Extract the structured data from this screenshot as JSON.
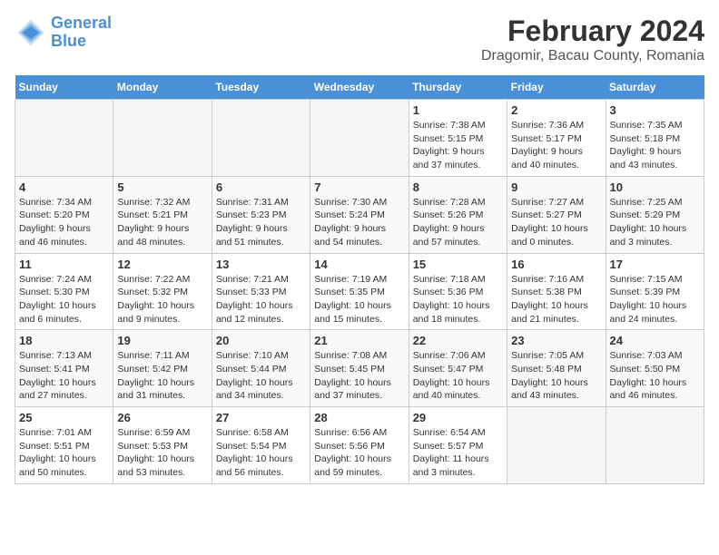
{
  "header": {
    "logo_line1": "General",
    "logo_line2": "Blue",
    "title": "February 2024",
    "subtitle": "Dragomir, Bacau County, Romania"
  },
  "weekdays": [
    "Sunday",
    "Monday",
    "Tuesday",
    "Wednesday",
    "Thursday",
    "Friday",
    "Saturday"
  ],
  "weeks": [
    [
      {
        "day": "",
        "info": ""
      },
      {
        "day": "",
        "info": ""
      },
      {
        "day": "",
        "info": ""
      },
      {
        "day": "",
        "info": ""
      },
      {
        "day": "1",
        "info": "Sunrise: 7:38 AM\nSunset: 5:15 PM\nDaylight: 9 hours\nand 37 minutes."
      },
      {
        "day": "2",
        "info": "Sunrise: 7:36 AM\nSunset: 5:17 PM\nDaylight: 9 hours\nand 40 minutes."
      },
      {
        "day": "3",
        "info": "Sunrise: 7:35 AM\nSunset: 5:18 PM\nDaylight: 9 hours\nand 43 minutes."
      }
    ],
    [
      {
        "day": "4",
        "info": "Sunrise: 7:34 AM\nSunset: 5:20 PM\nDaylight: 9 hours\nand 46 minutes."
      },
      {
        "day": "5",
        "info": "Sunrise: 7:32 AM\nSunset: 5:21 PM\nDaylight: 9 hours\nand 48 minutes."
      },
      {
        "day": "6",
        "info": "Sunrise: 7:31 AM\nSunset: 5:23 PM\nDaylight: 9 hours\nand 51 minutes."
      },
      {
        "day": "7",
        "info": "Sunrise: 7:30 AM\nSunset: 5:24 PM\nDaylight: 9 hours\nand 54 minutes."
      },
      {
        "day": "8",
        "info": "Sunrise: 7:28 AM\nSunset: 5:26 PM\nDaylight: 9 hours\nand 57 minutes."
      },
      {
        "day": "9",
        "info": "Sunrise: 7:27 AM\nSunset: 5:27 PM\nDaylight: 10 hours\nand 0 minutes."
      },
      {
        "day": "10",
        "info": "Sunrise: 7:25 AM\nSunset: 5:29 PM\nDaylight: 10 hours\nand 3 minutes."
      }
    ],
    [
      {
        "day": "11",
        "info": "Sunrise: 7:24 AM\nSunset: 5:30 PM\nDaylight: 10 hours\nand 6 minutes."
      },
      {
        "day": "12",
        "info": "Sunrise: 7:22 AM\nSunset: 5:32 PM\nDaylight: 10 hours\nand 9 minutes."
      },
      {
        "day": "13",
        "info": "Sunrise: 7:21 AM\nSunset: 5:33 PM\nDaylight: 10 hours\nand 12 minutes."
      },
      {
        "day": "14",
        "info": "Sunrise: 7:19 AM\nSunset: 5:35 PM\nDaylight: 10 hours\nand 15 minutes."
      },
      {
        "day": "15",
        "info": "Sunrise: 7:18 AM\nSunset: 5:36 PM\nDaylight: 10 hours\nand 18 minutes."
      },
      {
        "day": "16",
        "info": "Sunrise: 7:16 AM\nSunset: 5:38 PM\nDaylight: 10 hours\nand 21 minutes."
      },
      {
        "day": "17",
        "info": "Sunrise: 7:15 AM\nSunset: 5:39 PM\nDaylight: 10 hours\nand 24 minutes."
      }
    ],
    [
      {
        "day": "18",
        "info": "Sunrise: 7:13 AM\nSunset: 5:41 PM\nDaylight: 10 hours\nand 27 minutes."
      },
      {
        "day": "19",
        "info": "Sunrise: 7:11 AM\nSunset: 5:42 PM\nDaylight: 10 hours\nand 31 minutes."
      },
      {
        "day": "20",
        "info": "Sunrise: 7:10 AM\nSunset: 5:44 PM\nDaylight: 10 hours\nand 34 minutes."
      },
      {
        "day": "21",
        "info": "Sunrise: 7:08 AM\nSunset: 5:45 PM\nDaylight: 10 hours\nand 37 minutes."
      },
      {
        "day": "22",
        "info": "Sunrise: 7:06 AM\nSunset: 5:47 PM\nDaylight: 10 hours\nand 40 minutes."
      },
      {
        "day": "23",
        "info": "Sunrise: 7:05 AM\nSunset: 5:48 PM\nDaylight: 10 hours\nand 43 minutes."
      },
      {
        "day": "24",
        "info": "Sunrise: 7:03 AM\nSunset: 5:50 PM\nDaylight: 10 hours\nand 46 minutes."
      }
    ],
    [
      {
        "day": "25",
        "info": "Sunrise: 7:01 AM\nSunset: 5:51 PM\nDaylight: 10 hours\nand 50 minutes."
      },
      {
        "day": "26",
        "info": "Sunrise: 6:59 AM\nSunset: 5:53 PM\nDaylight: 10 hours\nand 53 minutes."
      },
      {
        "day": "27",
        "info": "Sunrise: 6:58 AM\nSunset: 5:54 PM\nDaylight: 10 hours\nand 56 minutes."
      },
      {
        "day": "28",
        "info": "Sunrise: 6:56 AM\nSunset: 5:56 PM\nDaylight: 10 hours\nand 59 minutes."
      },
      {
        "day": "29",
        "info": "Sunrise: 6:54 AM\nSunset: 5:57 PM\nDaylight: 11 hours\nand 3 minutes."
      },
      {
        "day": "",
        "info": ""
      },
      {
        "day": "",
        "info": ""
      }
    ]
  ]
}
